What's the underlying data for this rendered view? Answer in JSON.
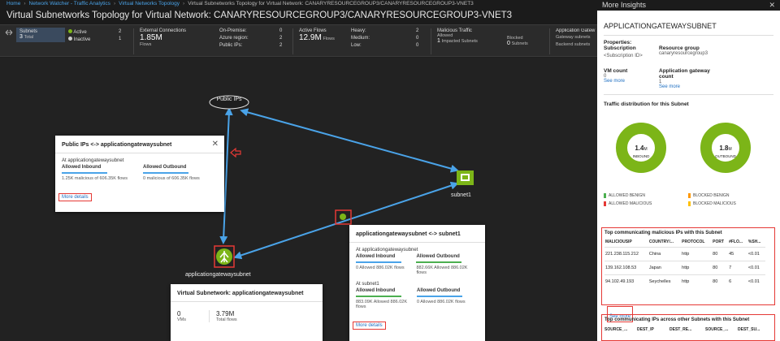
{
  "breadcrumb": {
    "items": [
      "Home",
      "Network Watcher - Traffic Analytics",
      "Virtual Networks Topology"
    ],
    "current": "Virtual Subnetworks Topology for Virtual Network: CANARYRESOURCEGROUP3/CANARYRESOURCEGROUP3-VNET3"
  },
  "title": "Virtual Subnetworks Topology for Virtual Network: CANARYRESOURCEGROUP3/CANARYRESOURCEGROUP3-VNET3",
  "stats": {
    "subnets": {
      "label": "Subnets",
      "value": "3",
      "sub": "Total"
    },
    "active": {
      "label": "Active",
      "value": "2"
    },
    "inactive": {
      "label": "Inactive",
      "value": "1"
    },
    "external": {
      "label": "External Connections",
      "value": "1.85M",
      "sub": "Flows"
    },
    "on_premise": {
      "label": "On-Premise:",
      "value": "0"
    },
    "azure_region": {
      "label": "Azure region:",
      "value": "2"
    },
    "public_ips": {
      "label": "Public IPs:",
      "value": "2"
    },
    "active_flows": {
      "label": "Active Flows",
      "value": "12.9M",
      "sub": "Flows"
    },
    "heavy": {
      "label": "Heavy:",
      "value": "2"
    },
    "medium": {
      "label": "Medium:",
      "value": "0"
    },
    "low": {
      "label": "Low:",
      "value": "0"
    },
    "malicious": {
      "label": "Malicious Traffic",
      "allowed_label": "Allowed",
      "allowed_value": "1",
      "allowed_sub": "Impacted Subnets",
      "blocked_label": "Blocked",
      "blocked_value": "0",
      "blocked_sub": "Subnets"
    },
    "app_gw": {
      "label": "Application Gatew",
      "line1": "Gateway subnets",
      "line2": "Backend subnets"
    }
  },
  "nodes": {
    "public_ips": "Public IPs",
    "subnet1": "subnet1",
    "appgw": "applicationgatewaysubnet"
  },
  "card_public": {
    "title": "Public IPs <-> applicationgatewaysubnet",
    "at": "At applicationgatewaysubnet",
    "inbound_label": "Allowed Inbound",
    "inbound_value": "1.25K malicious of 606.35K flows",
    "outbound_label": "Allowed Outbound",
    "outbound_value": "0 malicious of 606.35K flows",
    "more": "More details"
  },
  "card_subnet": {
    "title": "applicationgatewaysubnet <-> subnet1",
    "at1": "At applicationgatewaysubnet",
    "in1_label": "Allowed Inbound",
    "in1_value": "0 Allowed 886.02K flows",
    "out1_label": "Allowed Outbound",
    "out1_value": "882.66K Allowed 886.02K flows",
    "at2": "At subnet1",
    "in2_label": "Allowed Inbound",
    "in2_value": "883.09K Allowed 886.02K flows",
    "out2_label": "Allowed Outbound",
    "out2_value": "0 Allowed 886.02K flows",
    "more": "More details"
  },
  "card_vsub": {
    "title": "Virtual Subnetwork: applicationgatewaysubnet",
    "vms_value": "0",
    "vms_label": "VMs",
    "flows_value": "3.79M",
    "flows_label": "Total flows"
  },
  "insights": {
    "header": "More Insights",
    "title": "APPLICATIONGATEWAYSUBNET",
    "properties": "Properties:",
    "subscription_label": "Subscription",
    "subscription_value": "<Subscription ID>",
    "rg_label": "Resource group",
    "rg_value": "canaryresourcegroup3",
    "vm_label": "VM count",
    "vm_value": "0",
    "vm_link": "See more",
    "agc_label": "Application gateway count",
    "agc_value": "1",
    "agc_link": "See more",
    "traffic_title": "Traffic distribution for this Subnet",
    "inbound_value": "1.4",
    "inbound_unit": "M",
    "inbound_label": "INBOUND",
    "outbound_value": "1.8",
    "outbound_unit": "M",
    "outbound_label": "OUTBOUND",
    "legend": [
      "ALLOWED BENIGN",
      "BLOCKED BENIGN",
      "ALLOWED MALICIOUS",
      "BLOCKED MALICIOUS"
    ],
    "legend_colors": [
      "#4caf50",
      "#ff9800",
      "#e53935",
      "#ffc107"
    ],
    "mal_title": "Top communicating malicious IPs with this Subnet",
    "mal_headers": [
      "MALICIOUSIP",
      "COUNTRY/...",
      "PROTOCOL",
      "PORT",
      "#FLO...",
      "%SH..."
    ],
    "mal_rows": [
      [
        "221.238.115.212",
        "China",
        "http",
        "80",
        "45",
        "<0.01"
      ],
      [
        "139.162.108.53",
        "Japan",
        "http",
        "80",
        "7",
        "<0.01"
      ],
      [
        "94.102.49.193",
        "Seychelles",
        "http",
        "80",
        "6",
        "<0.01"
      ]
    ],
    "see_more": "See more",
    "other_title": "Top communicating IPs across other Subnets with this Subnet",
    "other_headers": [
      "SOURCE_...",
      "DEST_IP",
      "DEST_RE...",
      "SOURCE_...",
      "DEST_SU..."
    ]
  },
  "colors": {
    "accent": "#4aa3e8",
    "node_green": "#7cb518",
    "highlight": "#e53935"
  }
}
